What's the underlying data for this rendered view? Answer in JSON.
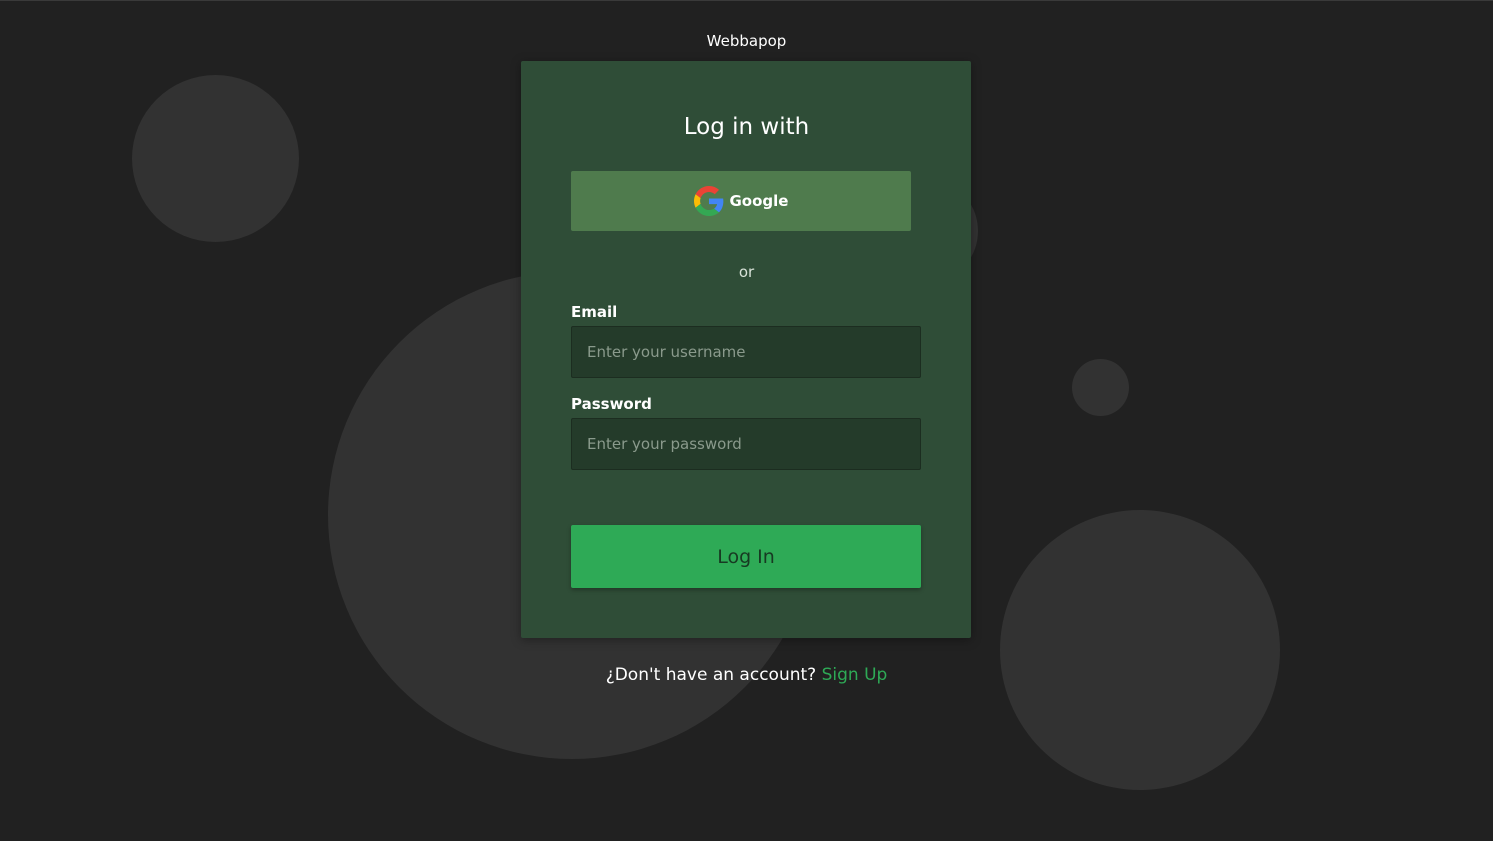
{
  "brand": {
    "name": "Webbapop"
  },
  "login": {
    "title": "Log in with",
    "google_label": "Google",
    "google_icon": "google-g-icon",
    "divider": "or",
    "email_label": "Email",
    "email_placeholder": "Enter your username",
    "email_value": "",
    "password_label": "Password",
    "password_placeholder": "Enter your password",
    "password_value": "",
    "submit_label": "Log In"
  },
  "footer": {
    "prompt": "¿Don't have an account?",
    "signup_label": "Sign Up"
  },
  "colors": {
    "background": "#212121",
    "bubble": "#323232",
    "card": "#2f4d37",
    "google_button": "#4f7b4d",
    "input": "#243b2a",
    "accent": "#2eaa56"
  }
}
